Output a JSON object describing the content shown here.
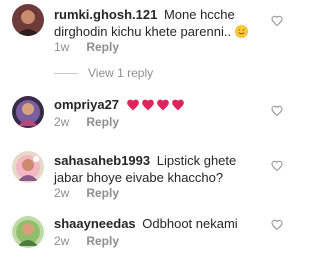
{
  "comments": [
    {
      "username": "rumki.ghosh.121",
      "text": "Mone hcche dirghodin kichu khete parenni..",
      "time": "1w",
      "reply_label": "Reply",
      "view_replies_label": "View 1 reply",
      "emoji": "smiling-face"
    },
    {
      "username": "ompriya27",
      "text": "",
      "hearts": [
        "red-heart",
        "red-heart",
        "red-heart",
        "red-heart"
      ],
      "time": "2w",
      "reply_label": "Reply"
    },
    {
      "username": "sahasaheb1993",
      "text": "Lipstick ghete jabar bhoye eivabe khaccho?",
      "time": "2w",
      "reply_label": "Reply"
    },
    {
      "username": "shaayneedas",
      "text": "Odbhoot nekami",
      "time": "2w",
      "reply_label": "Reply"
    }
  ],
  "colors": {
    "username": "#262626",
    "meta": "#8e8e8e",
    "heart_outline": "#999999",
    "red_heart": "#e0245e"
  }
}
